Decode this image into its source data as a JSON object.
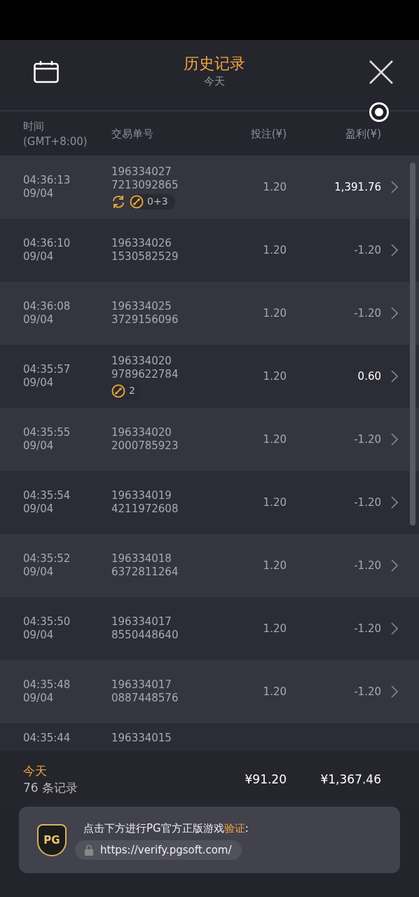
{
  "header": {
    "title": "历史记录",
    "subtitle": "今天"
  },
  "columns": [
    {
      "label": "时间",
      "sublabel": "(GMT+8:00)"
    },
    {
      "label": "交易单号"
    },
    {
      "label": "投注(¥)"
    },
    {
      "label": "盈利(¥)"
    }
  ],
  "rows": [
    {
      "time": "04:36:13",
      "date": "09/04",
      "order": [
        "196334027",
        "7213092865"
      ],
      "badges": [
        {
          "kind": "refresh"
        },
        {
          "kind": "free",
          "text": "0+3"
        }
      ],
      "bet": "1.20",
      "profit": "1,391.76",
      "win": true
    },
    {
      "time": "04:36:10",
      "date": "09/04",
      "order": [
        "196334026",
        "1530582529"
      ],
      "bet": "1.20",
      "profit": "-1.20",
      "win": false
    },
    {
      "time": "04:36:08",
      "date": "09/04",
      "order": [
        "196334025",
        "3729156096"
      ],
      "bet": "1.20",
      "profit": "-1.20",
      "win": false
    },
    {
      "time": "04:35:57",
      "date": "09/04",
      "order": [
        "196334020",
        "9789622784"
      ],
      "badges": [
        {
          "kind": "free",
          "text": "2"
        }
      ],
      "bet": "1.20",
      "profit": "0.60",
      "win": true
    },
    {
      "time": "04:35:55",
      "date": "09/04",
      "order": [
        "196334020",
        "2000785923"
      ],
      "bet": "1.20",
      "profit": "-1.20",
      "win": false
    },
    {
      "time": "04:35:54",
      "date": "09/04",
      "order": [
        "196334019",
        "4211972608"
      ],
      "bet": "1.20",
      "profit": "-1.20",
      "win": false
    },
    {
      "time": "04:35:52",
      "date": "09/04",
      "order": [
        "196334018",
        "6372811264"
      ],
      "bet": "1.20",
      "profit": "-1.20",
      "win": false
    },
    {
      "time": "04:35:50",
      "date": "09/04",
      "order": [
        "196334017",
        "8550448640"
      ],
      "bet": "1.20",
      "profit": "-1.20",
      "win": false
    },
    {
      "time": "04:35:48",
      "date": "09/04",
      "order": [
        "196334017",
        "0887448576"
      ],
      "bet": "1.20",
      "profit": "-1.20",
      "win": false
    },
    {
      "time": "04:35:44",
      "order": [
        "196334015"
      ],
      "partial": true
    }
  ],
  "summary": {
    "period": "今天",
    "count": "76 条记录",
    "bet_total": "¥91.20",
    "profit_total": "¥1,367.46"
  },
  "verify": {
    "logo": "PG",
    "text": "点击下方进行PG官方正版游戏**验证**:",
    "url": "https://verify.pgsoft.com/"
  }
}
